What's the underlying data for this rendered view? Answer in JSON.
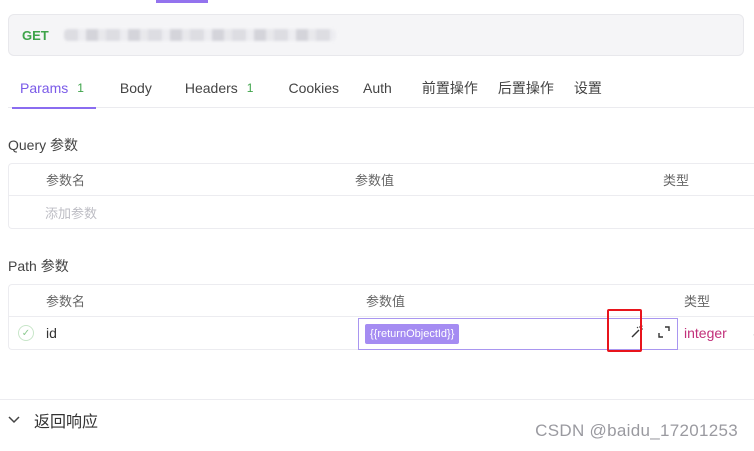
{
  "request": {
    "method": "GET"
  },
  "tabs": [
    {
      "label": "Params",
      "count": "1"
    },
    {
      "label": "Body",
      "count": ""
    },
    {
      "label": "Headers",
      "count": "1"
    },
    {
      "label": "Cookies",
      "count": ""
    },
    {
      "label": "Auth",
      "count": ""
    },
    {
      "label": "前置操作",
      "count": ""
    },
    {
      "label": "后置操作",
      "count": ""
    },
    {
      "label": "设置",
      "count": ""
    }
  ],
  "query": {
    "title": "Query 参数",
    "headers": {
      "name": "参数名",
      "value": "参数值",
      "type": "类型"
    },
    "add_placeholder": "添加参数"
  },
  "path": {
    "title": "Path 参数",
    "headers": {
      "name": "参数名",
      "value": "参数值",
      "type": "类型"
    },
    "row": {
      "name": "id",
      "value": "{{returnObjectId}}",
      "type": "integer"
    }
  },
  "response": {
    "label": "返回响应"
  },
  "watermark": "CSDN @baidu_17201253",
  "icons": {
    "magic": "magic-wand-icon",
    "expand": "expand-icon",
    "check": "check-circle-icon",
    "chevron": "chevron-down-icon"
  },
  "colors": {
    "accent": "#8a6cf0",
    "method": "#3ea44a",
    "type": "#c2307a",
    "highlight": "#e8141c"
  }
}
